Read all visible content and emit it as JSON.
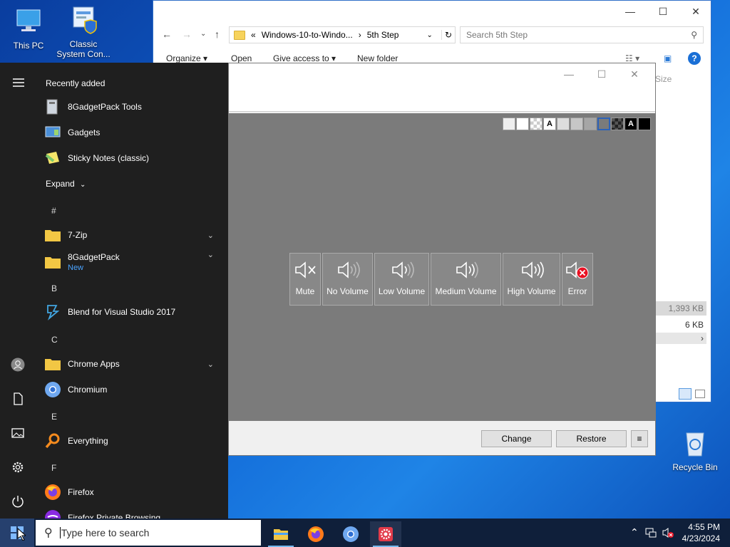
{
  "desktop": {
    "icons": [
      {
        "label": "This PC",
        "icon": "monitor-icon"
      },
      {
        "label": "Classic System Con...",
        "icon": "control-panel-icon"
      },
      {
        "label": "Recycle Bin",
        "icon": "recycle-bin-icon"
      }
    ]
  },
  "explorer": {
    "breadcrumb": {
      "overflow": "«",
      "part1": "Windows-10-to-Windo...",
      "separator": "›",
      "part2": "5th Step"
    },
    "search_placeholder": "Search 5th Step",
    "ribbon": {
      "organize": "Organize",
      "open": "Open",
      "give_access": "Give access to",
      "new_folder": "New folder"
    },
    "column_size": "Size",
    "rows": [
      "1,393 KB",
      "6 KB"
    ]
  },
  "dialog": {
    "swatch_letter": "A",
    "tiles": [
      {
        "label": "Mute",
        "icon": "speaker-mute-icon"
      },
      {
        "label": "No Volume",
        "icon": "speaker-no-volume-icon"
      },
      {
        "label": "Low Volume",
        "icon": "speaker-low-volume-icon"
      },
      {
        "label": "Medium Volume",
        "icon": "speaker-medium-volume-icon"
      },
      {
        "label": "High Volume",
        "icon": "speaker-high-volume-icon"
      },
      {
        "label": "Error",
        "icon": "speaker-error-icon"
      }
    ],
    "buttons": {
      "change": "Change",
      "restore": "Restore",
      "menu": "≡"
    }
  },
  "start_menu": {
    "recently_added": "Recently added",
    "recent": [
      {
        "label": "8GadgetPack Tools"
      },
      {
        "label": "Gadgets"
      },
      {
        "label": "Sticky Notes (classic)"
      }
    ],
    "expand": "Expand",
    "letters": {
      "hash": "#",
      "b": "B",
      "c": "C",
      "e": "E",
      "f": "F"
    },
    "apps": {
      "zip": "7-Zip",
      "gadgetpack": "8GadgetPack",
      "gadgetpack_badge": "New",
      "blend": "Blend for Visual Studio 2017",
      "chrome_apps": "Chrome Apps",
      "chromium": "Chromium",
      "everything": "Everything",
      "firefox": "Firefox",
      "firefox_private": "Firefox Private Browsing"
    }
  },
  "taskbar": {
    "search_placeholder": "Type here to search",
    "time": "4:55 PM",
    "date": "4/23/2024"
  }
}
